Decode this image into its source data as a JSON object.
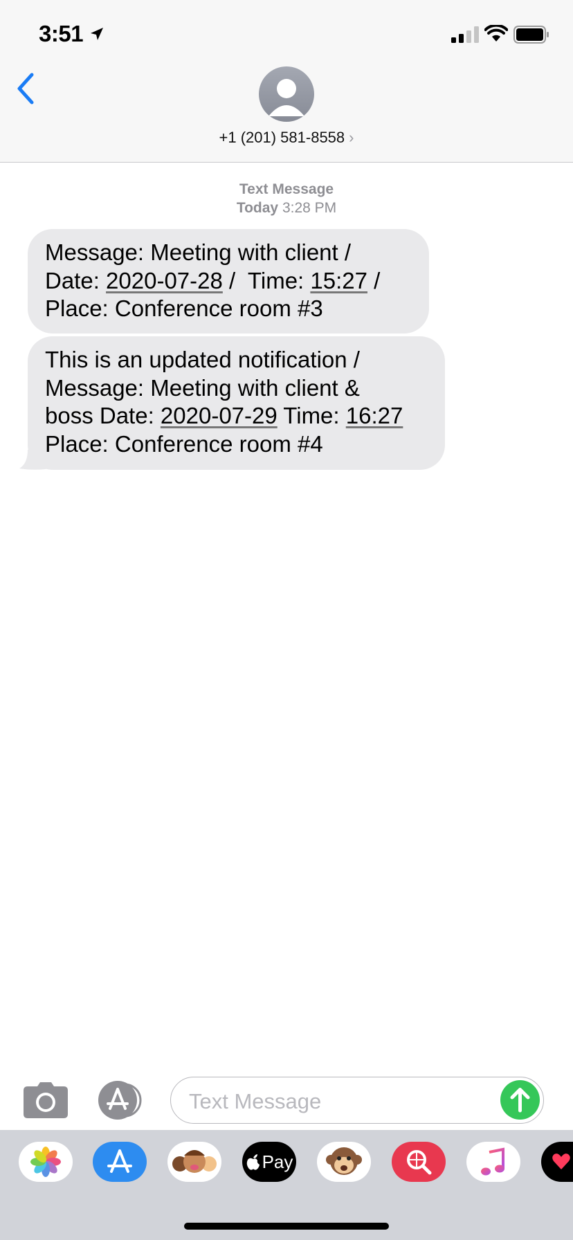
{
  "status_bar": {
    "time": "3:51"
  },
  "header": {
    "contact": "+1 (201) 581-8558",
    "chevron": "›"
  },
  "thread": {
    "service": "Text Message",
    "day": "Today",
    "time": "3:28 PM"
  },
  "messages": [
    {
      "line1": "Message: Meeting with client /",
      "line2_a": "Date: ",
      "line2_date": "2020-07-28",
      "line2_b": " /  Time: ",
      "line2_time": "15:27",
      "line2_c": " /",
      "line3": "Place: Conference room #3"
    },
    {
      "line1": "This is an updated notification /",
      "line2": "Message: Meeting with client &",
      "line3_a": "boss Date: ",
      "line3_date": "2020-07-29",
      "line3_b": " Time: ",
      "line3_time": "16:27",
      "line4": "Place: Conference room #4"
    }
  ],
  "composer": {
    "placeholder": "Text Message"
  },
  "apple_pay_label": "Pay",
  "colors": {
    "accent": "#1a7cf5",
    "send": "#35c759",
    "bubble": "#e9e9eb"
  },
  "icons": [
    "back-chevron-icon",
    "camera-icon",
    "app-store-icon",
    "send-arrow-icon",
    "photos-app-icon",
    "memoji-icon",
    "apple-pay-icon",
    "animoji-icon",
    "images-search-icon",
    "music-icon",
    "digital-touch-icon"
  ]
}
